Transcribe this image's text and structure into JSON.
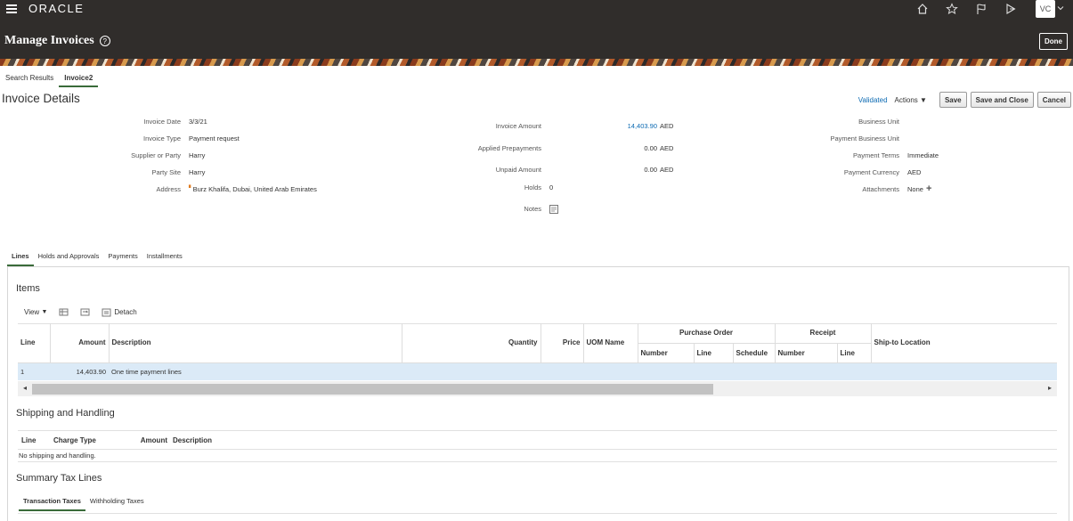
{
  "header": {
    "logo": "ORACLE",
    "page_title": "Manage Invoices",
    "help": "?",
    "done_label": "Done",
    "avatar": "VC",
    "icons": [
      "home-icon",
      "star-icon",
      "flag-icon",
      "notification-icon"
    ]
  },
  "tabs": [
    {
      "label": "Search Results"
    },
    {
      "label": "Invoice2"
    }
  ],
  "section_title": "Invoice Details",
  "action_bar": {
    "status": "Validated",
    "actions": "Actions",
    "save": "Save",
    "save_close": "Save and Close",
    "cancel": "Cancel"
  },
  "fields": {
    "invoice_date": {
      "label": "Invoice Date",
      "value": "3/3/21"
    },
    "invoice_type": {
      "label": "Invoice Type",
      "value": "Payment request"
    },
    "supplier": {
      "label": "Supplier or Party",
      "value": "Harry"
    },
    "party_site": {
      "label": "Party Site",
      "value": "Harry"
    },
    "address": {
      "label": "Address",
      "value": "Burz Khalifa, Dubai, United Arab Emirates"
    },
    "invoice_amount": {
      "label": "Invoice Amount",
      "value": "14,403.90",
      "currency": "AED"
    },
    "applied_prepayments": {
      "label": "Applied Prepayments",
      "value": "0.00",
      "currency": "AED"
    },
    "unpaid_amount": {
      "label": "Unpaid Amount",
      "value": "0.00",
      "currency": "AED"
    },
    "holds": {
      "label": "Holds",
      "value": "0"
    },
    "notes": {
      "label": "Notes"
    },
    "business_unit": {
      "label": "Business Unit",
      "value": ""
    },
    "payment_business_unit": {
      "label": "Payment Business Unit",
      "value": ""
    },
    "payment_terms": {
      "label": "Payment Terms",
      "value": "Immediate"
    },
    "payment_currency": {
      "label": "Payment Currency",
      "value": "AED"
    },
    "attachments": {
      "label": "Attachments",
      "value": "None"
    }
  },
  "sub_tabs": [
    {
      "label": "Lines"
    },
    {
      "label": "Holds and Approvals"
    },
    {
      "label": "Payments"
    },
    {
      "label": "Installments"
    }
  ],
  "items": {
    "title": "Items",
    "view": "View",
    "detach": "Detach",
    "columns": {
      "line": "Line",
      "amount": "Amount",
      "description": "Description",
      "quantity": "Quantity",
      "price": "Price",
      "uom": "UOM Name",
      "po_group": "Purchase Order",
      "po_number": "Number",
      "po_line": "Line",
      "po_schedule": "Schedule",
      "receipt_group": "Receipt",
      "receipt_number": "Number",
      "receipt_line": "Line",
      "ship_to": "Ship-to Location"
    },
    "rows": [
      {
        "line": "1",
        "amount": "14,403.90",
        "description": "One time payment lines"
      }
    ]
  },
  "shipping": {
    "title": "Shipping and Handling",
    "columns": {
      "line": "Line",
      "charge_type": "Charge Type",
      "amount": "Amount",
      "description": "Description"
    },
    "empty": "No shipping and handling."
  },
  "summary_tax": {
    "title": "Summary Tax Lines",
    "tabs": [
      {
        "label": "Transaction Taxes"
      },
      {
        "label": "Withholding Taxes"
      }
    ]
  }
}
